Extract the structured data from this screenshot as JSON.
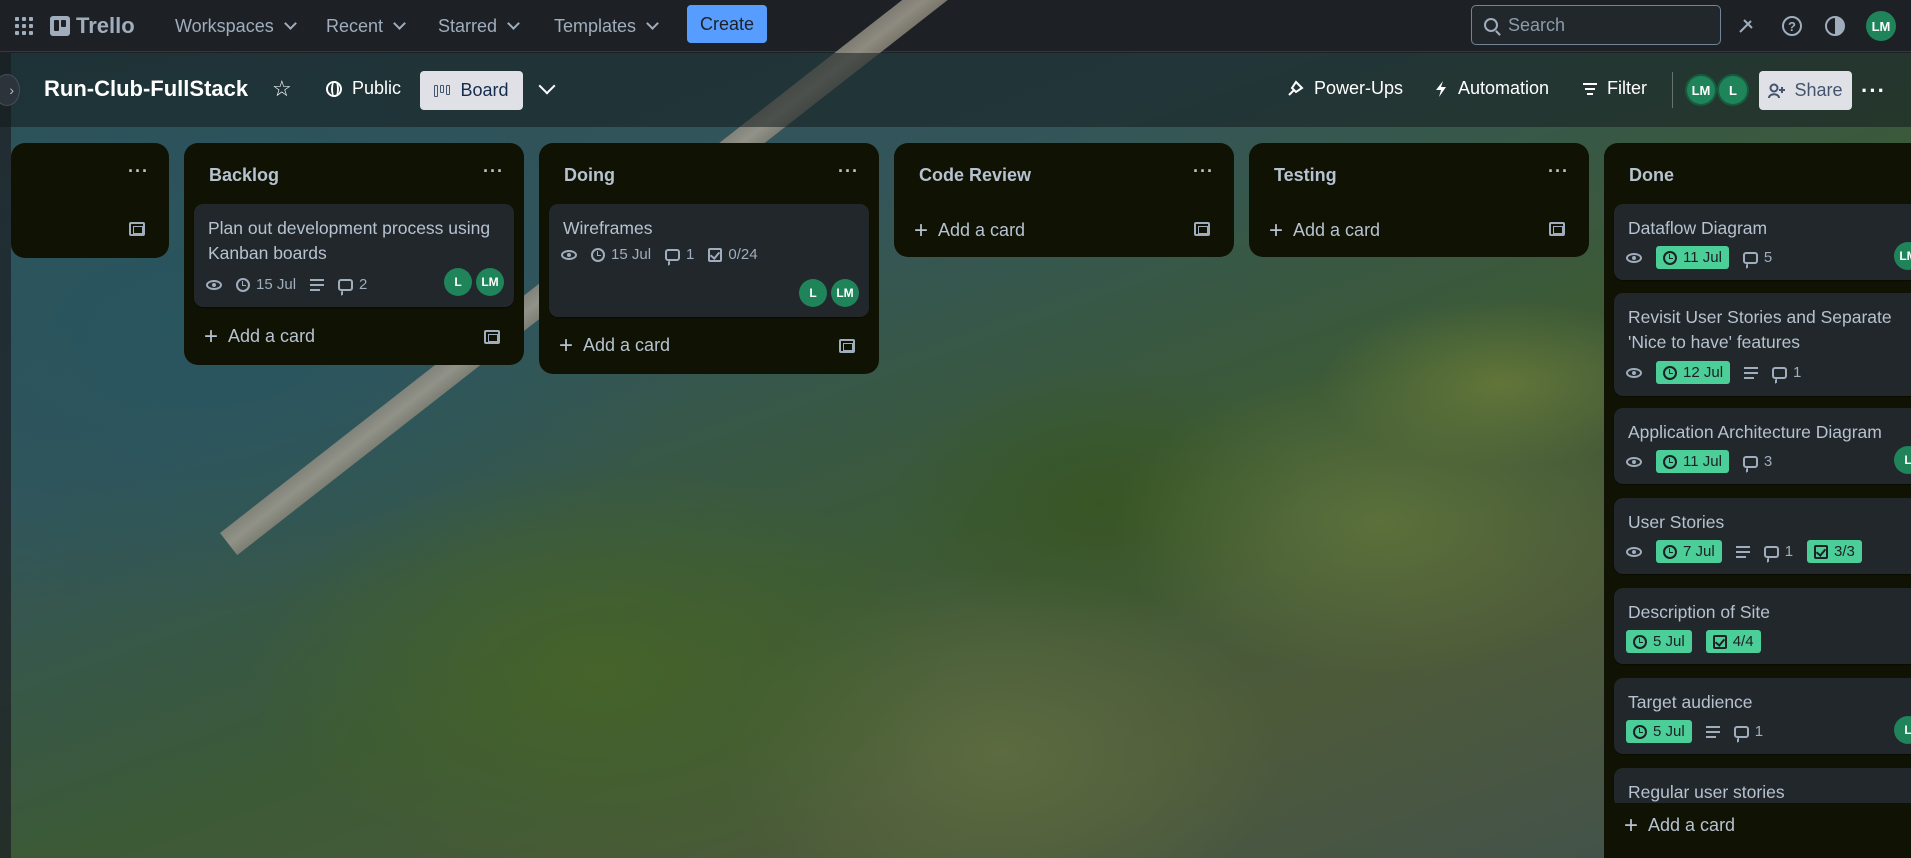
{
  "nav": {
    "logo": "Trello",
    "menus": [
      "Workspaces",
      "Recent",
      "Starred",
      "Templates"
    ],
    "create_label": "Create",
    "search_placeholder": "Search",
    "user_initials": "LM"
  },
  "board": {
    "title": "Run-Club-FullStack",
    "visibility": "Public",
    "view": "Board",
    "powerups": "Power-Ups",
    "automation": "Automation",
    "filter": "Filter",
    "members": [
      "LM",
      "L"
    ],
    "share": "Share"
  },
  "add_card_label": "Add a card",
  "lists": [
    {
      "title": "Backlog",
      "cards": [
        {
          "title_line1": "Plan out development process using",
          "title_line2": "Kanban boards",
          "date": "15 Jul",
          "comments": "2",
          "members": [
            "L",
            "LM"
          ]
        }
      ]
    },
    {
      "title": "Doing",
      "cards": [
        {
          "title": "Wireframes",
          "date": "15 Jul",
          "comments": "1",
          "checklist": "0/24",
          "members": [
            "L",
            "LM"
          ]
        }
      ]
    },
    {
      "title": "Code Review",
      "cards": []
    },
    {
      "title": "Testing",
      "cards": []
    },
    {
      "title": "Done",
      "cards": [
        {
          "title": "Dataflow Diagram",
          "date": "11 Jul",
          "comments": "5",
          "members": [
            "LM"
          ]
        },
        {
          "title_line1": "Revisit User Stories and Separate",
          "title_line2": "'Nice to have' features",
          "date": "12 Jul",
          "comments": "1"
        },
        {
          "title": "Application Architecture Diagram",
          "date": "11 Jul",
          "comments": "3",
          "members": [
            "L"
          ]
        },
        {
          "title": "User Stories",
          "date": "7 Jul",
          "comments": "1",
          "checklist": "3/3"
        },
        {
          "title": "Description of Site",
          "date": "5 Jul",
          "checklist": "4/4"
        },
        {
          "title": "Target audience",
          "date": "5 Jul",
          "comments": "1",
          "members": [
            "L"
          ]
        },
        {
          "title": "Regular user stories"
        }
      ]
    }
  ],
  "colors": {
    "accent": "#579dff",
    "list_bg": "#101204",
    "card_bg": "#22272b",
    "badge_complete": "#4bce97",
    "member_avatar": "#1f845a"
  }
}
